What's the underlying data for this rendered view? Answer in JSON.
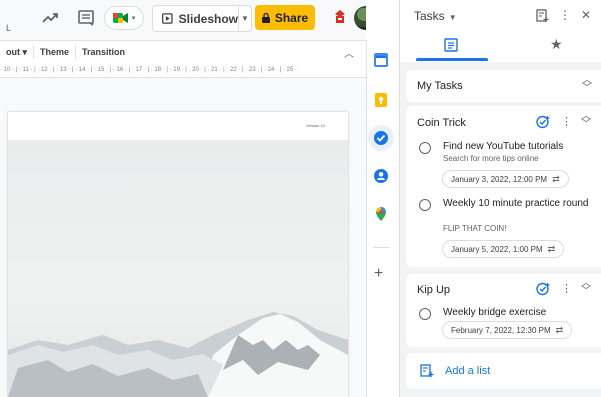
{
  "toolbar": {
    "small_letter": "L",
    "slideshow_label": "Slideshow",
    "share_label": "Share",
    "icons": [
      "trending-icon",
      "comment-icon",
      "meet-icon",
      "present-icon",
      "lock-icon",
      "caret-down-icon",
      "collapse-icon"
    ]
  },
  "menu": {
    "items": [
      "out ▾",
      "Theme",
      "Transition"
    ]
  },
  "ruler": {
    "text": "· 10 · | · 11 · | · 12 · | · 13 · | · 14 · | · 15 · | · 16 · | · 17 · | · 18 · | · 19 · | · 20 · | · 21 · | · 22 · | · 23 · | · 24 · | · 25 ·"
  },
  "slide": {
    "version_text": "Version 10"
  },
  "side_strip": {
    "icons": [
      "calendar-icon",
      "keep-icon",
      "tasks-icon",
      "contacts-icon",
      "maps-icon",
      "add-icon"
    ]
  },
  "tasks": {
    "title": "Tasks",
    "my_tasks_label": "My Tasks",
    "lists": [
      {
        "name": "Coin Trick",
        "items": [
          {
            "title": "Find new YouTube tutorials",
            "notes": "Search for more tips online",
            "date": "January 3, 2022, 12:00 PM"
          },
          {
            "title": "Weekly 10 minute practice round",
            "notes": "FLIP THAT COIN!",
            "date": "January 5, 2022, 1:00 PM"
          }
        ]
      },
      {
        "name": "Kip Up",
        "items": [
          {
            "title": "Weekly bridge exercise",
            "notes": "",
            "date": "February 7, 2022, 12:30 PM"
          }
        ]
      }
    ],
    "add_list_label": "Add a list"
  },
  "colors": {
    "accent": "#1a73e8",
    "share": "#fbbc04",
    "panel_bg": "#f1f3f4"
  }
}
